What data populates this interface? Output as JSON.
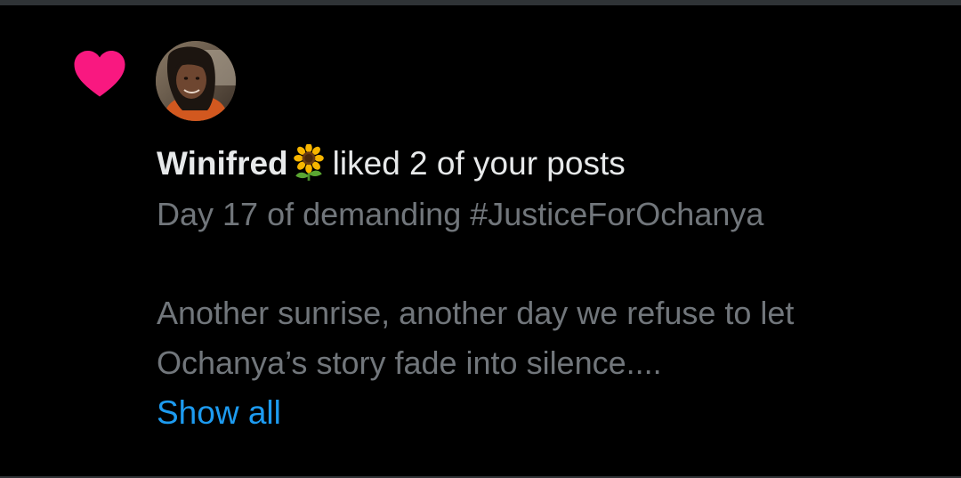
{
  "notification": {
    "type_icon": "heart-icon",
    "heart_color": "#f91880",
    "avatar": "avatar-photo",
    "username": "Winifred",
    "username_emoji": "sunflower",
    "action_text": "liked 2 of your posts",
    "post": {
      "title_line": "Day 17 of demanding #JusticeForOchanya",
      "body_line_1": "Another sunrise, another day we refuse to let",
      "body_line_2": "Ochanya’s story fade into silence....",
      "show_all_label": "Show all"
    }
  },
  "colors": {
    "background": "#000000",
    "primary_text": "#e7e9ea",
    "secondary_text": "#71767b",
    "link": "#1d9bf0",
    "divider": "#2f3336"
  }
}
